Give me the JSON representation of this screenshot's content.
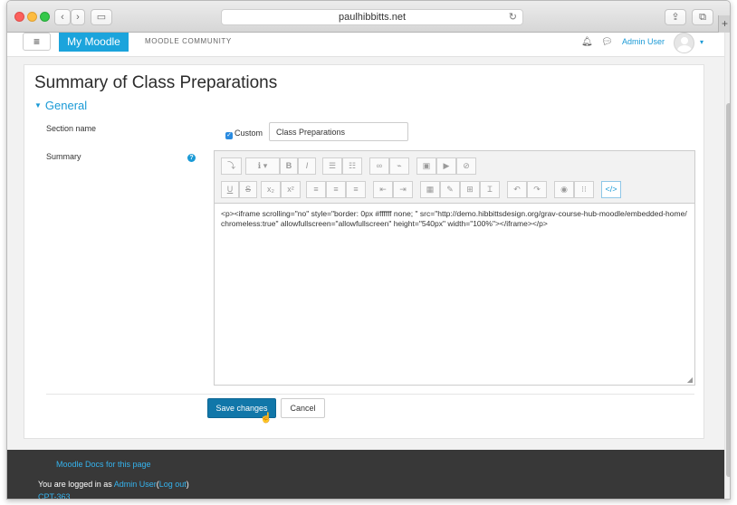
{
  "browser": {
    "address": "paulhibbitts.net",
    "new_tab": "+"
  },
  "navbar": {
    "menu_icon": "≡",
    "brand": "My Moodle",
    "community": "MOODLE COMMUNITY",
    "user": "Admin User"
  },
  "page": {
    "title": "Summary of Class Preparations",
    "section_legend": "General"
  },
  "form": {
    "section_name_label": "Section name",
    "custom_label": "Custom",
    "custom_checked": true,
    "section_name_value": "Class Preparations",
    "summary_label": "Summary",
    "summary_html": "<p><iframe scrolling=\"no\" style=\"border: 0px #ffffff none; \" src=\"http://demo.hibbittsdesign.org/grav-course-hub-moodle/embedded-home/chromeless:true\" allowfullscreen=\"allowfullscreen\" height=\"540px\" width=\"100%\"></iframe></p>",
    "save_label": "Save changes",
    "cancel_label": "Cancel"
  },
  "editor_toolbar": {
    "row1": [
      "collapse",
      "paragraph-style",
      "bold",
      "italic",
      "unordered-list",
      "ordered-list",
      "link",
      "unlink",
      "image",
      "media",
      "manage-files"
    ],
    "row2": [
      "underline",
      "strikethrough",
      "subscript",
      "superscript",
      "align-left",
      "align-center",
      "align-right",
      "outdent",
      "indent",
      "equation",
      "special-char",
      "table",
      "clear-formatting",
      "undo",
      "redo",
      "accessibility-checker",
      "screenreader-helper",
      "html"
    ],
    "labels": {
      "collapse": "⤵",
      "paragraph": "ℹ ▾",
      "bold": "B",
      "italic": "I",
      "underline": "U",
      "strike": "S",
      "sub": "x₂",
      "sup": "x²",
      "html": "</>"
    }
  },
  "footer": {
    "docs_link": "Moodle Docs for this page",
    "logged_in_prefix": "You are logged in as ",
    "logged_in_user": "Admin User",
    "logout": "Log out",
    "course_code": "CPT-363"
  }
}
